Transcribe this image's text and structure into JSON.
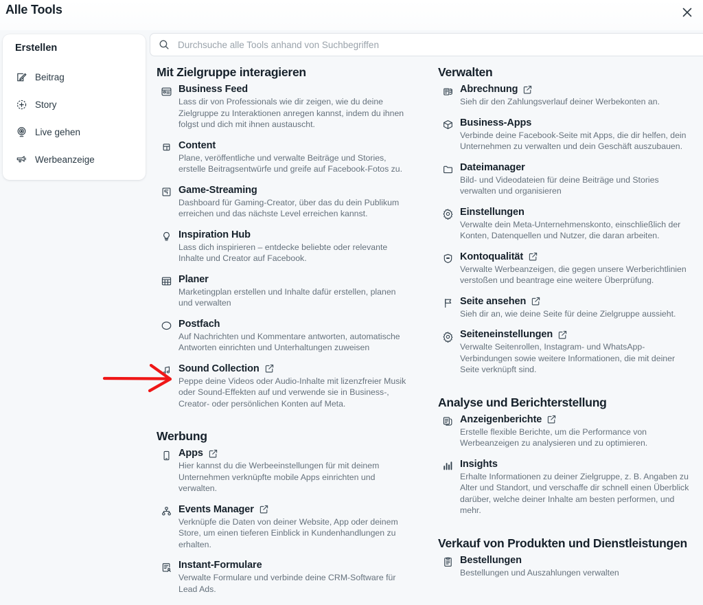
{
  "header": {
    "title": "Alle Tools",
    "close_icon": "close-icon",
    "close_label": "✕"
  },
  "search": {
    "placeholder": "Durchsuche alle Tools anhand von Suchbegriffen",
    "value": "",
    "icon": "search-icon"
  },
  "sidebar": {
    "heading": "Erstellen",
    "items": [
      {
        "label": "Beitrag",
        "icon": "pencil-square-icon"
      },
      {
        "label": "Story",
        "icon": "plus-circle-icon"
      },
      {
        "label": "Live gehen",
        "icon": "broadcast-icon"
      },
      {
        "label": "Werbeanzeige",
        "icon": "megaphone-icon"
      }
    ]
  },
  "left_column": {
    "sections": [
      {
        "title": "Mit Zielgruppe interagieren",
        "tools": [
          {
            "name": "Business Feed",
            "icon": "feed-card-icon",
            "external": false,
            "desc": "Lass dir von Professionals wie dir zeigen, wie du deine Zielgruppe zu Interaktionen anregen kannst, indem du ihnen folgst und dich mit ihnen austauscht."
          },
          {
            "name": "Content",
            "icon": "content-copy-icon",
            "external": false,
            "desc": "Plane, veröffentliche und verwalte Beiträge und Stories, erstelle Beitragsentwürfe und greife auf Facebook-Fotos zu."
          },
          {
            "name": "Game-Streaming",
            "icon": "game-streaming-icon",
            "external": false,
            "desc": "Dashboard für Gaming-Creator, über das du dein Publikum erreichen und das nächste Level erreichen kannst."
          },
          {
            "name": "Inspiration Hub",
            "icon": "lightbulb-icon",
            "external": false,
            "desc": "Lass dich inspirieren – entdecke beliebte oder relevante Inhalte und Creator auf Facebook."
          },
          {
            "name": "Planer",
            "icon": "calendar-grid-icon",
            "external": false,
            "desc": "Marketingplan erstellen und Inhalte dafür erstellen, planen und verwalten"
          },
          {
            "name": "Postfach",
            "icon": "chat-bubble-icon",
            "external": false,
            "desc": "Auf Nachrichten und Kommentare antworten, automatische Antworten einrichten und Unterhaltungen zuweisen"
          },
          {
            "name": "Sound Collection",
            "icon": "music-note-icon",
            "external": true,
            "desc": "Peppe deine Videos oder Audio-Inhalte mit lizenzfreier Musik oder Sound-Effekten auf und verwende sie in Business-, Creator- oder persönlichen Konten auf Meta."
          }
        ]
      },
      {
        "title": "Werbung",
        "tools": [
          {
            "name": "Apps",
            "icon": "mobile-phone-icon",
            "external": true,
            "desc": "Hier kannst du die Werbeeinstellungen für mit deinem Unternehmen verknüpfte mobile Apps einrichten und verwalten."
          },
          {
            "name": "Events Manager",
            "icon": "events-node-icon",
            "external": true,
            "desc": "Verknüpfe die Daten von deiner Website, App oder deinem Store, um einen tieferen Einblick in Kundenhandlungen zu erhalten."
          },
          {
            "name": "Instant-Formulare",
            "icon": "form-person-icon",
            "external": false,
            "desc": "Verwalte Formulare und verbinde deine CRM-Software für Lead Ads."
          }
        ]
      }
    ]
  },
  "right_column": {
    "sections": [
      {
        "title": "Verwalten",
        "tools": [
          {
            "name": "Abrechnung",
            "icon": "billing-stack-icon",
            "external": true,
            "desc": "Sieh dir den Zahlungsverlauf deiner Werbekonten an."
          },
          {
            "name": "Business-Apps",
            "icon": "cube-icon",
            "external": false,
            "desc": "Verbinde deine Facebook-Seite mit Apps, die dir helfen, dein Unternehmen zu verwalten und dein Geschäft auszubauen."
          },
          {
            "name": "Dateimanager",
            "icon": "folder-icon",
            "external": false,
            "desc": "Bild- und Videodateien für deine Beiträge und Stories verwalten und organisieren"
          },
          {
            "name": "Einstellungen",
            "icon": "gear-icon",
            "external": false,
            "desc": "Verwalte dein Meta-Unternehmenskonto, einschließlich der Konten, Datenquellen und Nutzer, die daran arbeiten."
          },
          {
            "name": "Kontoqualität",
            "icon": "shield-icon",
            "external": true,
            "desc": "Verwalte Werbeanzeigen, die gegen unsere Werberichtlinien verstoßen und beantrage eine weitere Überprüfung."
          },
          {
            "name": "Seite ansehen",
            "icon": "flag-icon",
            "external": true,
            "desc": "Sieh dir an, wie deine Seite für deine Zielgruppe aussieht."
          },
          {
            "name": "Seiteneinstellungen",
            "icon": "gear-icon",
            "external": true,
            "desc": "Verwalte Seitenrollen, Instagram- und WhatsApp-Verbindungen sowie weitere Informationen, die mit deiner Seite verknüpft sind."
          }
        ]
      },
      {
        "title": "Analyse und Berichterstellung",
        "tools": [
          {
            "name": "Anzeigenberichte",
            "icon": "reports-pages-icon",
            "external": true,
            "desc": "Erstelle flexible Berichte, um die Performance von Werbeanzeigen zu analysieren und zu optimieren."
          },
          {
            "name": "Insights",
            "icon": "bar-chart-icon",
            "external": false,
            "desc": "Erhalte Informationen zu deiner Zielgruppe, z. B. Angaben zu Alter und Standort, und verschaffe dir schnell einen Überblick darüber, welche deiner Inhalte am besten performen, und mehr."
          }
        ]
      },
      {
        "title": "Verkauf von Produkten und Dienstleistungen",
        "tools": [
          {
            "name": "Bestellungen",
            "icon": "clipboard-icon",
            "external": false,
            "desc": "Bestellungen und Auszahlungen verwalten"
          }
        ]
      }
    ]
  },
  "annotation": {
    "type": "red-arrow",
    "color": "#ef1717",
    "points_to": "Sound Collection"
  }
}
